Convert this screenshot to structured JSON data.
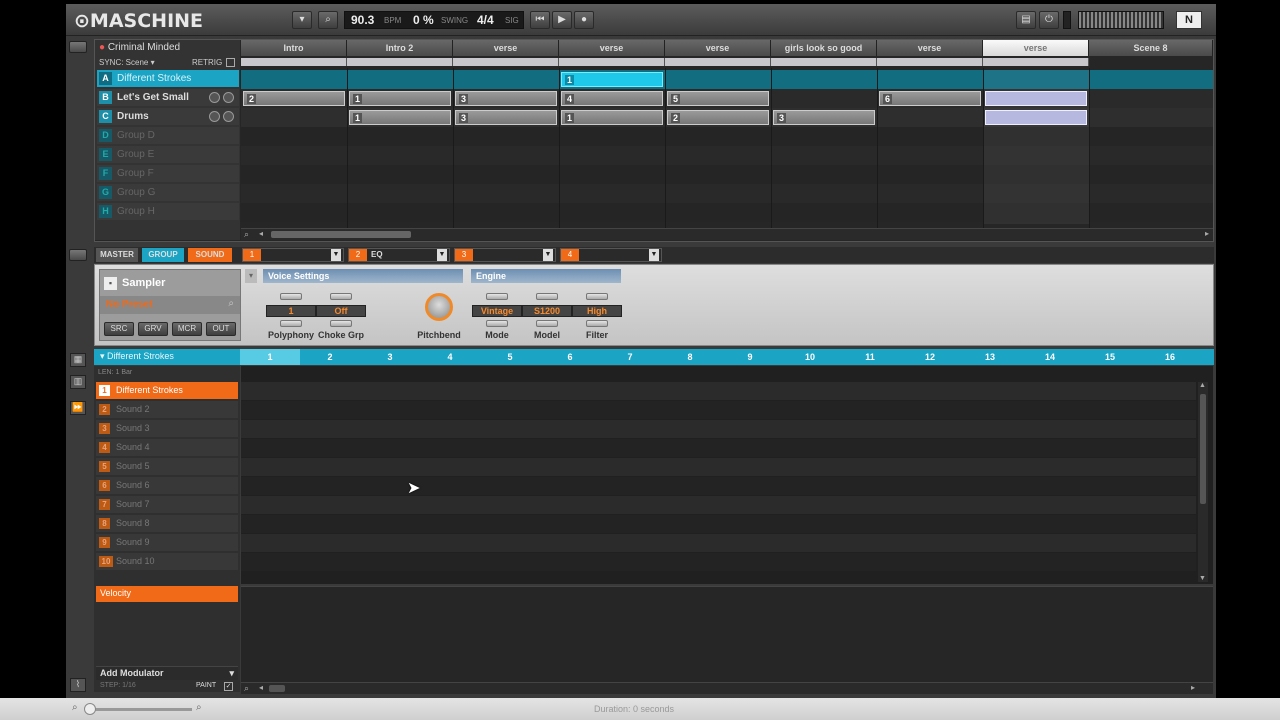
{
  "app": {
    "logo": "MASCHINE"
  },
  "transport": {
    "tempo": "90.3",
    "tempo_unit": "BPM",
    "swing": "0 %",
    "swing_label": "SWING",
    "signature": "4/4",
    "signature_label": "SIG"
  },
  "arranger": {
    "song_name": "Criminal Minded",
    "sync_label": "SYNC: Scene ▾",
    "retrig_label": "RETRIG",
    "scenes": [
      "Intro",
      "Intro 2",
      "verse",
      "verse",
      "verse",
      "girls look so good",
      "verse",
      "verse",
      "Scene 8"
    ],
    "groups": [
      {
        "letter": "A",
        "name": "Different Strokes",
        "active": true
      },
      {
        "letter": "B",
        "name": "Let's Get Small",
        "active": true
      },
      {
        "letter": "C",
        "name": "Drums",
        "active": true
      },
      {
        "letter": "D",
        "name": "Group D",
        "active": false
      },
      {
        "letter": "E",
        "name": "Group E",
        "active": false
      },
      {
        "letter": "F",
        "name": "Group F",
        "active": false
      },
      {
        "letter": "G",
        "name": "Group G",
        "active": false
      },
      {
        "letter": "H",
        "name": "Group H",
        "active": false
      }
    ],
    "clips_a": [
      "1"
    ],
    "clips_b": [
      "2",
      "1",
      "3",
      "4",
      "5",
      "6"
    ],
    "clips_c": [
      "1",
      "3",
      "1",
      "2",
      "3"
    ]
  },
  "control": {
    "tabs": {
      "master": "MASTER",
      "group": "GROUP",
      "sound": "SOUND"
    },
    "slots": [
      {
        "idx": "1",
        "name": ""
      },
      {
        "idx": "2",
        "name": "EQ"
      },
      {
        "idx": "3",
        "name": ""
      },
      {
        "idx": "4",
        "name": ""
      }
    ],
    "plugin_name": "Sampler",
    "preset": "No Preset",
    "plugin_buttons": [
      "SRC",
      "GRV",
      "MCR",
      "OUT"
    ],
    "section_voice": "Voice Settings",
    "section_engine": "Engine",
    "params": [
      {
        "label": "Polyphony",
        "value": "1"
      },
      {
        "label": "Choke Grp",
        "value": "Off"
      },
      {
        "label": "Pitchbend",
        "value": ""
      },
      {
        "label": "Mode",
        "value": "Vintage"
      },
      {
        "label": "Model",
        "value": "S1200"
      },
      {
        "label": "Filter",
        "value": "High"
      }
    ]
  },
  "pattern": {
    "group_name": "Different Strokes",
    "length_label": "LEN: 1 Bar",
    "steps": [
      "1",
      "2",
      "3",
      "4",
      "5",
      "6",
      "7",
      "8",
      "9",
      "10",
      "11",
      "12",
      "13",
      "14",
      "15",
      "16"
    ],
    "sounds": [
      "Different Strokes",
      "Sound 2",
      "Sound 3",
      "Sound 4",
      "Sound 5",
      "Sound 6",
      "Sound 7",
      "Sound 8",
      "Sound 9",
      "Sound 10"
    ],
    "velocity_label": "Velocity",
    "add_modulator": "Add Modulator",
    "step_label": "STEP: 1/16",
    "paint_label": "PAINT"
  },
  "status": {
    "duration": "Duration: 0 seconds"
  },
  "colors": {
    "accent_cyan": "#1ba4c4",
    "accent_orange": "#f06a18",
    "clip_lavender": "#b7b8df"
  }
}
